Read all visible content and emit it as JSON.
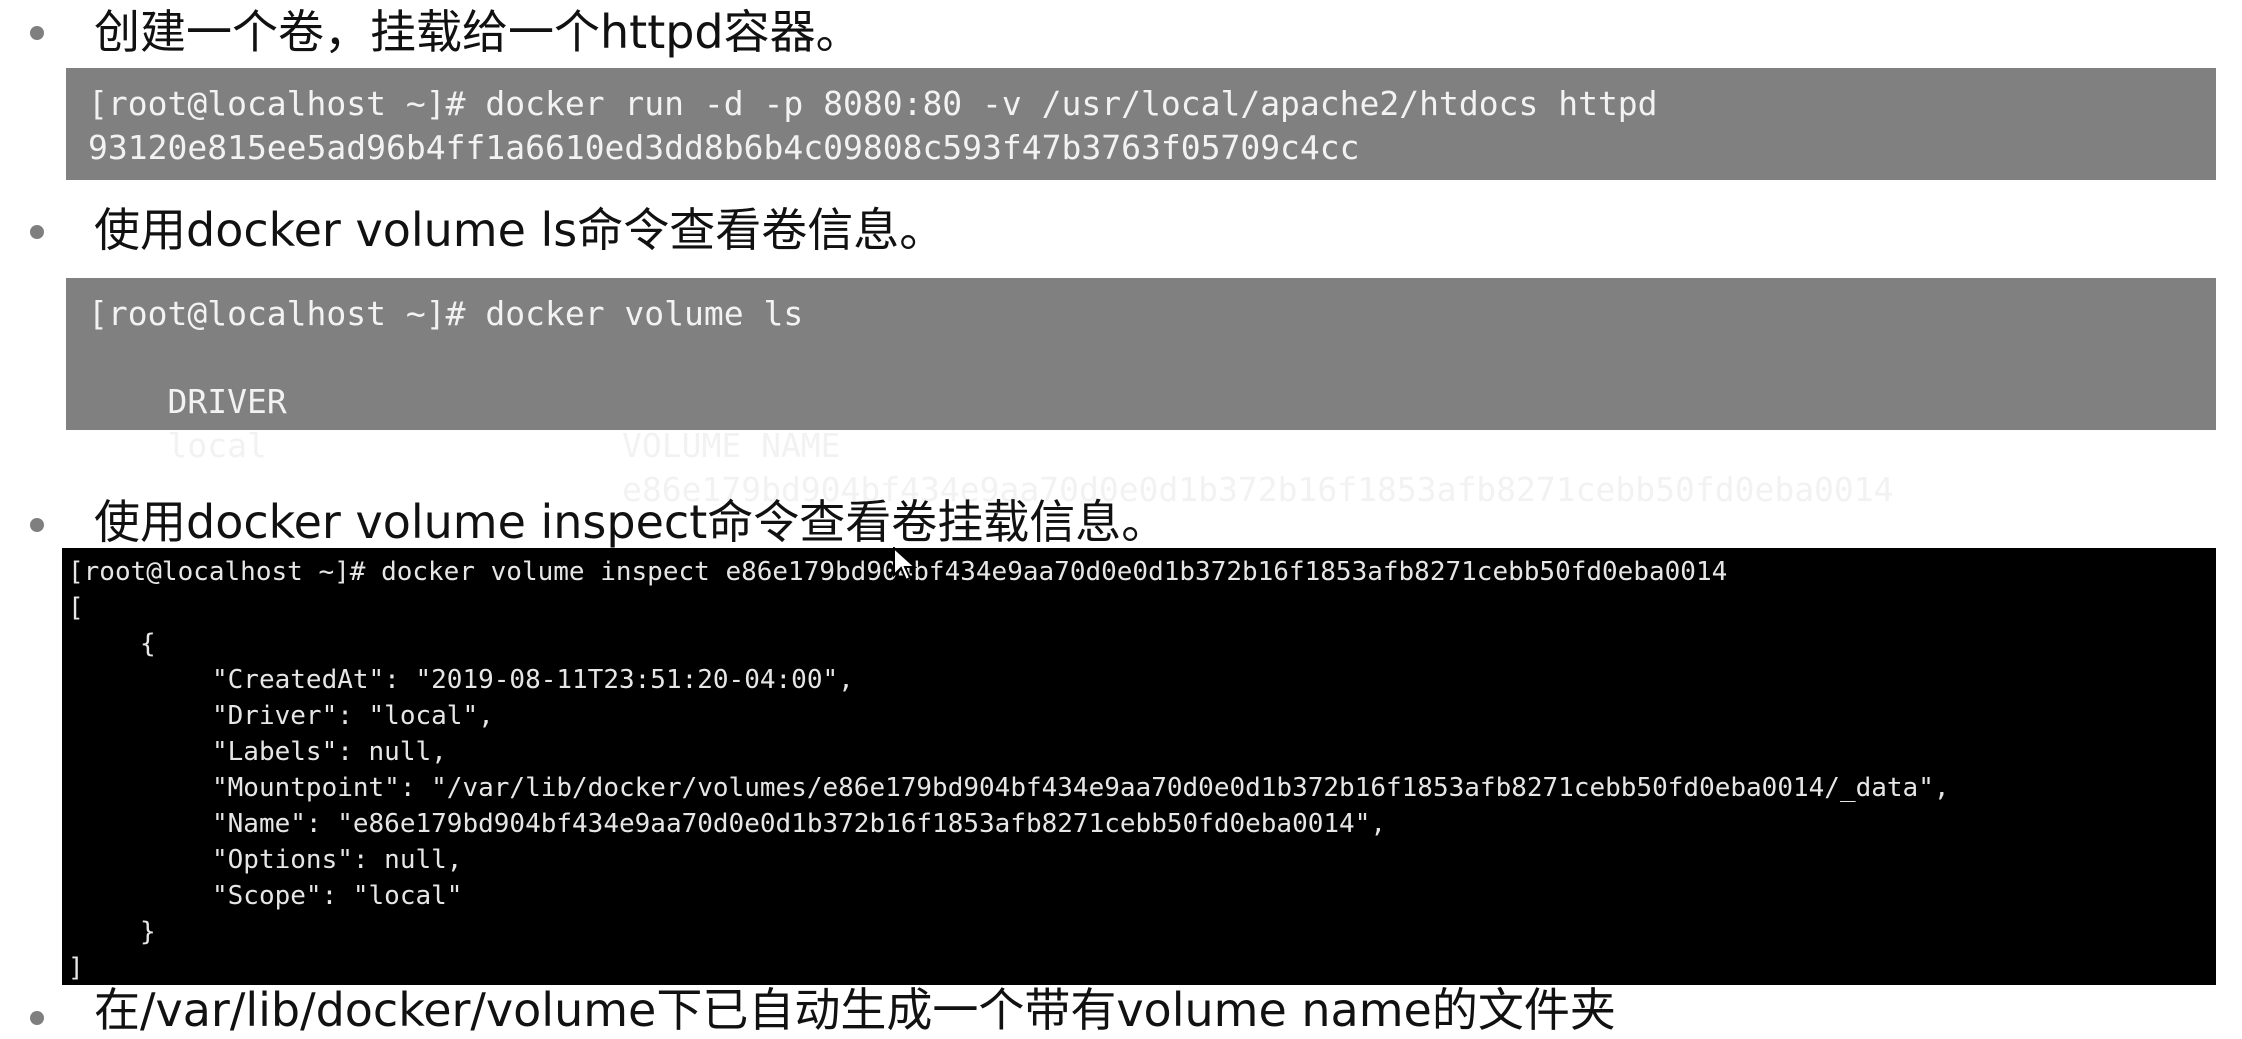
{
  "sections": [
    {
      "heading": "创建一个卷，挂载给一个httpd容器。"
    },
    {
      "heading": "使用docker volume ls命令查看卷信息。"
    },
    {
      "heading": "使用docker volume inspect命令查看卷挂载信息。"
    },
    {
      "heading": "在/var/lib/docker/volume下已自动生成一个带有volume name的文件夹"
    }
  ],
  "block1": {
    "line1": "[root@localhost ~]# docker run -d -p 8080:80 -v /usr/local/apache2/htdocs httpd",
    "line2": "93120e815ee5ad96b4ff1a6610ed3dd8b6b4c09808c593f47b3763f05709c4cc"
  },
  "block2": {
    "line1": "[root@localhost ~]# docker volume ls",
    "header_driver": "DRIVER",
    "header_volume_name": "VOLUME NAME",
    "row_driver": "local",
    "row_volume_name": "e86e179bd904bf434e9aa70d0e0d1b372b16f1853afb8271cebb50fd0eba0014"
  },
  "terminal": {
    "lines": [
      "[root@localhost ~]# docker volume inspect e86e179bd904bf434e9aa70d0e0d1b372b16f1853afb8271cebb50fd0eba0014",
      "[",
      "{",
      "\"CreatedAt\": \"2019-08-11T23:51:20-04:00\",",
      "\"Driver\": \"local\",",
      "\"Labels\": null,",
      "\"Mountpoint\": \"/var/lib/docker/volumes/e86e179bd904bf434e9aa70d0e0d1b372b16f1853afb8271cebb50fd0eba0014/_data\",",
      "\"Name\": \"e86e179bd904bf434e9aa70d0e0d1b372b16f1853afb8271cebb50fd0eba0014\",",
      "\"Options\": null,",
      "\"Scope\": \"local\"",
      "}",
      "]"
    ]
  },
  "icons": {
    "bullet": "bullet-dot-icon",
    "cursor": "mouse-pointer-icon"
  },
  "colors": {
    "grey_block_bg": "#808080",
    "terminal_bg": "#000000",
    "bullet": "#7f7f7f"
  }
}
